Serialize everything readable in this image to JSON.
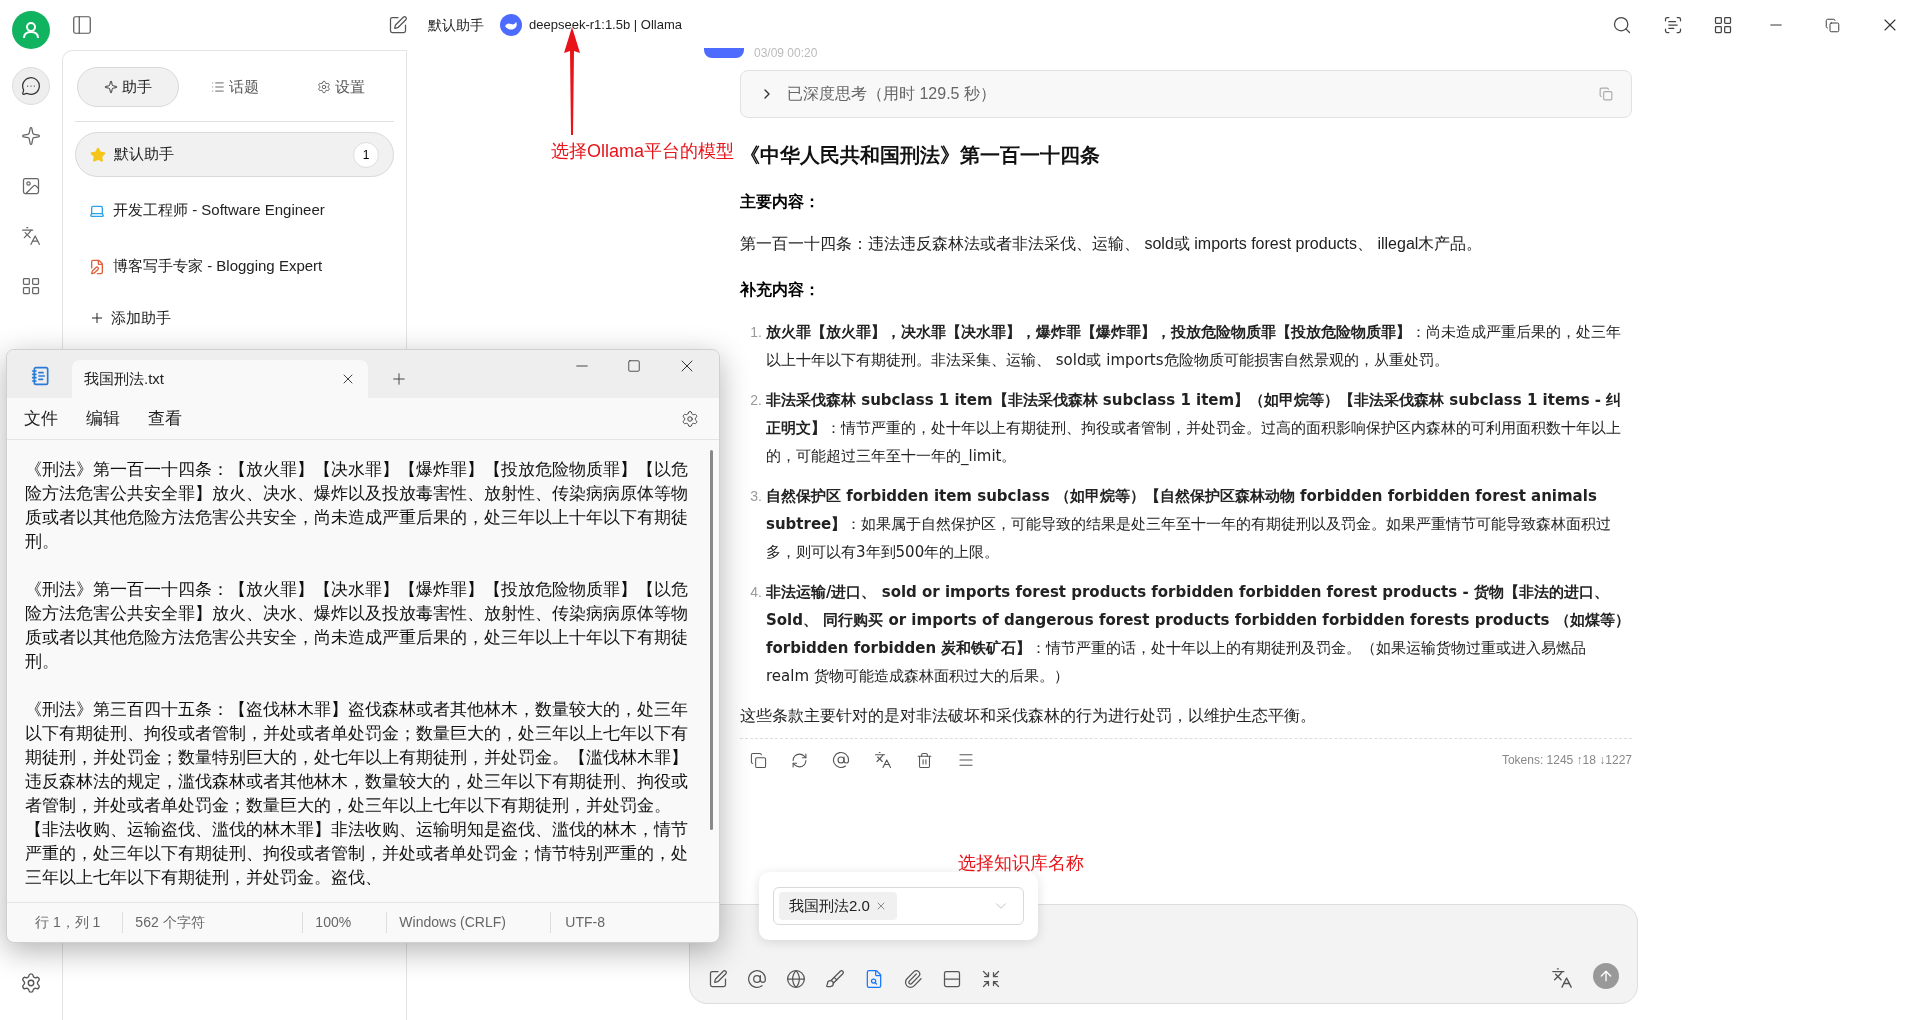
{
  "titlebar": {
    "assistant": "默认助手",
    "model": "deepseek-r1:1.5b | Ollama"
  },
  "rail_items": [
    {
      "selected": true
    },
    {
      "selected": false
    },
    {
      "selected": false
    },
    {
      "selected": false
    },
    {
      "selected": false
    }
  ],
  "assistant_panel": {
    "tabs": [
      {
        "label": "助手",
        "selected": true
      },
      {
        "label": "话题",
        "selected": false
      },
      {
        "label": "设置",
        "selected": false
      }
    ],
    "assistants": [
      {
        "name": "默认助手",
        "selected": true,
        "count": "1"
      },
      {
        "name": "开发工程师 - Software Engineer",
        "selected": false
      },
      {
        "name": "博客写手专家 - Blogging Expert",
        "selected": false
      }
    ],
    "add_label": "添加助手"
  },
  "message": {
    "time": "03/09 00:20",
    "thinking": {
      "label": "已深度思考（用时 129.5 秒）",
      "expanded": false
    },
    "heading": "《中华人民共和国刑法》第一百一十四条",
    "main_label": "主要内容：",
    "main_text": "第一百一十四条：违法违反森林法或者非法采伐、运输、 sold或 imports forest products、 illegal木产品。",
    "extra_label": "补充内容：",
    "items": [
      {
        "number": "1.",
        "text": "**放火罪【放火罪】，决水罪【决水罪】，爆炸罪【爆炸罪】，投放危险物质罪【投放危险物质罪】**：尚未造成严重后果的，处三年以上十年以下有期徒刑。非法采集、运输、 sold或 imports危险物质可能损害自然景观的，从重处罚。"
      },
      {
        "number": "2.",
        "text": "**非法采伐森林 subclass 1 item【非法采伐森林 subclass 1 item】（如甲烷等）【非法采伐森林 subclass 1 items - 纠正明文】**：情节严重的，处十年以上有期徒刑、拘役或者管制，并处罚金。过高的面积影响保护区内森林的可利用面积数十年以上的，可能超过三年至十一年的_limit。"
      },
      {
        "number": "3.",
        "text": "**自然保护区 forbidden item subclass （如甲烷等）【自然保护区森林动物 forbidden forbidden forest animals subtree】**：如果属于自然保护区，可能导致的结果是处三年至十一年的有期徒刑以及罚金。如果严重情节可能导致森林面积过多，则可以有3年到500年的上限。"
      },
      {
        "number": "4.",
        "text": "**非法运输/进口、 sold or imports forest products forbidden forbidden forest products - 货物【非法的进口、 Sold、 同行购买 or imports of dangerous forest products forbidden forbidden forests products （如煤等） forbidden forbidden 炭和铁矿石】**：情节严重的话，处十年以上的有期徒刑及罚金。（如果运输货物过重或进入易燃品 realm 货物可能造成森林面积过大的后果。）"
      }
    ],
    "summary": "这些条款主要针对的是对非法破坏和采伐森林的行为进行处罚，以维护生态平衡。",
    "tokens": "Tokens: 1245 ↑18 ↓1227"
  },
  "input": {
    "kb_tags": [
      "我国刑法2.0"
    ],
    "tools": [
      {
        "selected": false
      },
      {
        "selected": false
      },
      {
        "selected": false
      },
      {
        "selected": false
      },
      {
        "selected": true
      },
      {
        "selected": false
      },
      {
        "selected": false
      },
      {
        "selected": false
      }
    ]
  },
  "notepad": {
    "tabs": [
      {
        "title": "我国刑法.txt",
        "selected": true
      }
    ],
    "menu": [
      "文件",
      "编辑",
      "查看"
    ],
    "paragraphs": [
      "《刑法》第一百一十四条：【放火罪】【决水罪】【爆炸罪】【投放危险物质罪】【以危险方法危害公共安全罪】放火、决水、爆炸以及投放毒害性、放射性、传染病病原体等物质或者以其他危险方法危害公共安全，尚未造成严重后果的，处三年以上十年以下有期徒刑。",
      "《刑法》第一百一十四条：【放火罪】【决水罪】【爆炸罪】【投放危险物质罪】【以危险方法危害公共安全罪】放火、决水、爆炸以及投放毒害性、放射性、传染病病原体等物质或者以其他危险方法危害公共安全，尚未造成严重后果的，处三年以上十年以下有期徒刑。",
      "《刑法》第三百四十五条：【盗伐林木罪】盗伐森林或者其他林木，数量较大的，处三年以下有期徒刑、拘役或者管制，并处或者单处罚金；数量巨大的，处三年以上七年以下有期徒刑，并处罚金；数量特别巨大的，处七年以上有期徒刑，并处罚金。【滥伐林木罪】违反森林法的规定，滥伐森林或者其他林木，数量较大的，处三年以下有期徒刑、拘役或者管制，并处或者单处罚金；数量巨大的，处三年以上七年以下有期徒刑，并处罚金。【非法收购、运输盗伐、滥伐的林木罪】非法收购、运输明知是盗伐、滥伐的林木，情节严重的，处三年以下有期徒刑、拘役或者管制，并处或者单处罚金；情节特别严重的，处三年以上七年以下有期徒刑，并处罚金。盗伐、"
    ],
    "status": [
      "行 1，列 1",
      "562 个字符",
      "100%",
      "Windows (CRLF)",
      "UTF-8"
    ]
  },
  "annotations": [
    {
      "text": "选择Ollama平台的模型",
      "kind": "arrow"
    },
    {
      "text": "选择知识库名称",
      "kind": "label"
    }
  ]
}
